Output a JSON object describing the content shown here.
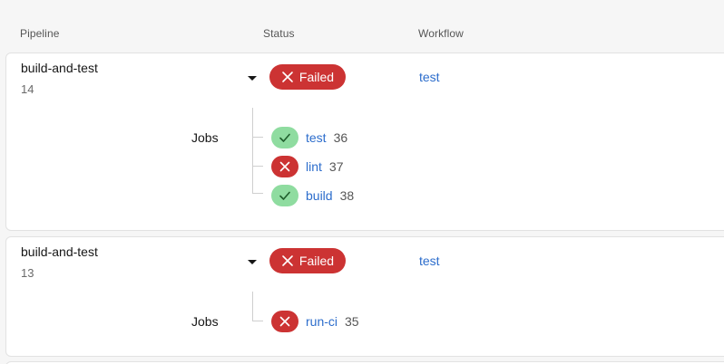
{
  "headers": {
    "pipeline": "Pipeline",
    "status": "Status",
    "workflow": "Workflow"
  },
  "colors": {
    "failed": "#cc3333",
    "success": "#8fdca0",
    "link": "#2c6dcc"
  },
  "pipelines": [
    {
      "name": "build-and-test",
      "number": "14",
      "status": "Failed",
      "workflow": "test",
      "jobs_label": "Jobs",
      "jobs": [
        {
          "name": "test",
          "number": "36",
          "status": "success"
        },
        {
          "name": "lint",
          "number": "37",
          "status": "failed"
        },
        {
          "name": "build",
          "number": "38",
          "status": "success"
        }
      ]
    },
    {
      "name": "build-and-test",
      "number": "13",
      "status": "Failed",
      "workflow": "test",
      "jobs_label": "Jobs",
      "jobs": [
        {
          "name": "run-ci",
          "number": "35",
          "status": "failed"
        }
      ]
    }
  ]
}
